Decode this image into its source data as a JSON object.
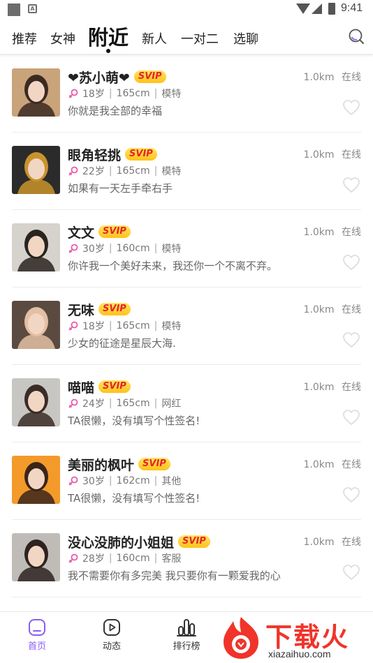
{
  "status_bar": {
    "time": "9:41",
    "badge_letter": "A"
  },
  "tabs": [
    {
      "label": "推荐"
    },
    {
      "label": "女神"
    },
    {
      "label": "附近"
    },
    {
      "label": "新人"
    },
    {
      "label": "一对二"
    },
    {
      "label": "选聊"
    }
  ],
  "active_tab": "附近",
  "users": [
    {
      "name": "❤苏小萌❤",
      "badge": "SVIP",
      "age": "18岁",
      "height": "165cm",
      "job": "模特",
      "signature": "你就是我全部的幸福",
      "distance": "1.0km",
      "status": "在线",
      "avatar_colors": [
        "#c9a37a",
        "#3b2a22"
      ]
    },
    {
      "name": "眼角轻挑",
      "badge": "SVIP",
      "age": "22岁",
      "height": "165cm",
      "job": "模特",
      "signature": "如果有一天左手牵右手",
      "distance": "1.0km",
      "status": "在线",
      "avatar_colors": [
        "#2b2b2b",
        "#c9932c"
      ]
    },
    {
      "name": "文文",
      "badge": "SVIP",
      "age": "30岁",
      "height": "160cm",
      "job": "模特",
      "signature": "你许我一个美好未来，我还你一个不离不弃。",
      "distance": "1.0km",
      "status": "在线",
      "avatar_colors": [
        "#d6d2cc",
        "#2a2420"
      ]
    },
    {
      "name": "无味",
      "badge": "SVIP",
      "age": "18岁",
      "height": "165cm",
      "job": "模特",
      "signature": "少女的征途是星辰大海.",
      "distance": "1.0km",
      "status": "在线",
      "avatar_colors": [
        "#5b4a3f",
        "#e3bfa5"
      ]
    },
    {
      "name": "喵喵",
      "badge": "SVIP",
      "age": "24岁",
      "height": "165cm",
      "job": "网红",
      "signature": "TA很懒，没有填写个性签名!",
      "distance": "1.0km",
      "status": "在线",
      "avatar_colors": [
        "#c8c6c3",
        "#3a2c26"
      ]
    },
    {
      "name": "美丽的枫叶",
      "badge": "SVIP",
      "age": "30岁",
      "height": "162cm",
      "job": "其他",
      "signature": "TA很懒，没有填写个性签名!",
      "distance": "1.0km",
      "status": "在线",
      "avatar_colors": [
        "#f39a2a",
        "#3a241a"
      ]
    },
    {
      "name": "没心没肺的小姐姐",
      "badge": "SVIP",
      "age": "28岁",
      "height": "160cm",
      "job": "客服",
      "signature": "我不需要你有多完美 我只要你有一颗爱我的心",
      "distance": "1.0km",
      "status": "在线",
      "avatar_colors": [
        "#bfbcb8",
        "#2c2320"
      ]
    }
  ],
  "bottom_nav": [
    {
      "label": "首页",
      "icon": "home-icon"
    },
    {
      "label": "动态",
      "icon": "play-icon"
    },
    {
      "label": "排行榜",
      "icon": "ranking-icon"
    }
  ],
  "watermark": {
    "text": "下载火",
    "url": "xiazaihuo.com"
  },
  "colors": {
    "accent": "#8a5cf6",
    "svip_text": "#e5232b",
    "female": "#e85aa8"
  }
}
